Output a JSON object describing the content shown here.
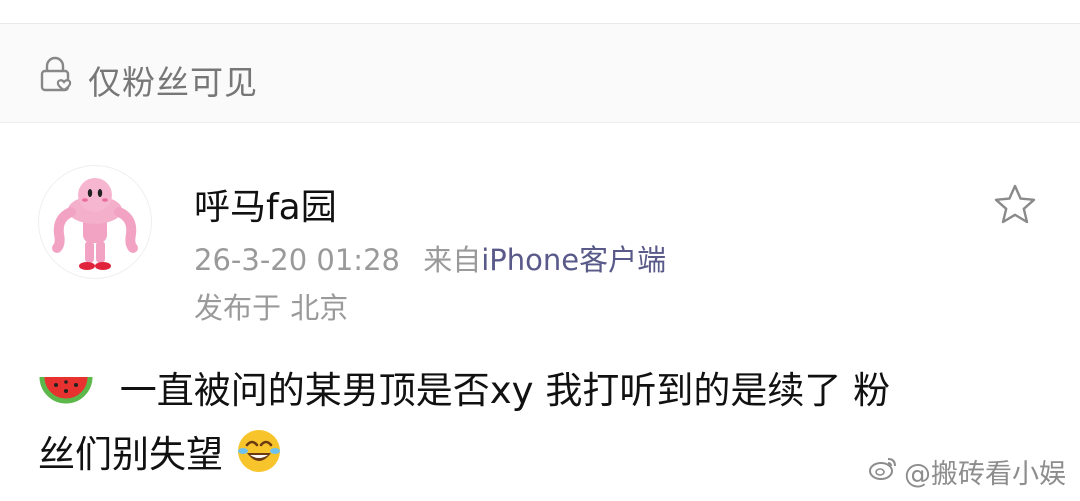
{
  "visibility": {
    "label": "仅粉丝可见",
    "icon": "lock-heart-icon"
  },
  "author": {
    "name": "呼马fa园",
    "avatar": "kirby-muscle-avatar"
  },
  "meta": {
    "time": "26-3-20 01:28",
    "from_prefix": "来自",
    "client": "iPhone客户端",
    "location": "发布于 北京"
  },
  "post": {
    "emoji_start": "watermelon-emoji",
    "text_line1": "一直被问的某男顶是否xy 我打听到的是续了 粉",
    "text_line2": "丝们别失望",
    "emoji_end": "laughing-crying-emoji"
  },
  "actions": {
    "favorite_icon": "star-icon"
  },
  "watermark": {
    "text": "@搬砖看小娱",
    "icon": "weibo-icon"
  },
  "colors": {
    "meta_gray": "#9a9a9a",
    "client_blue": "#5a5a8a",
    "bar_bg": "#fafafa"
  }
}
